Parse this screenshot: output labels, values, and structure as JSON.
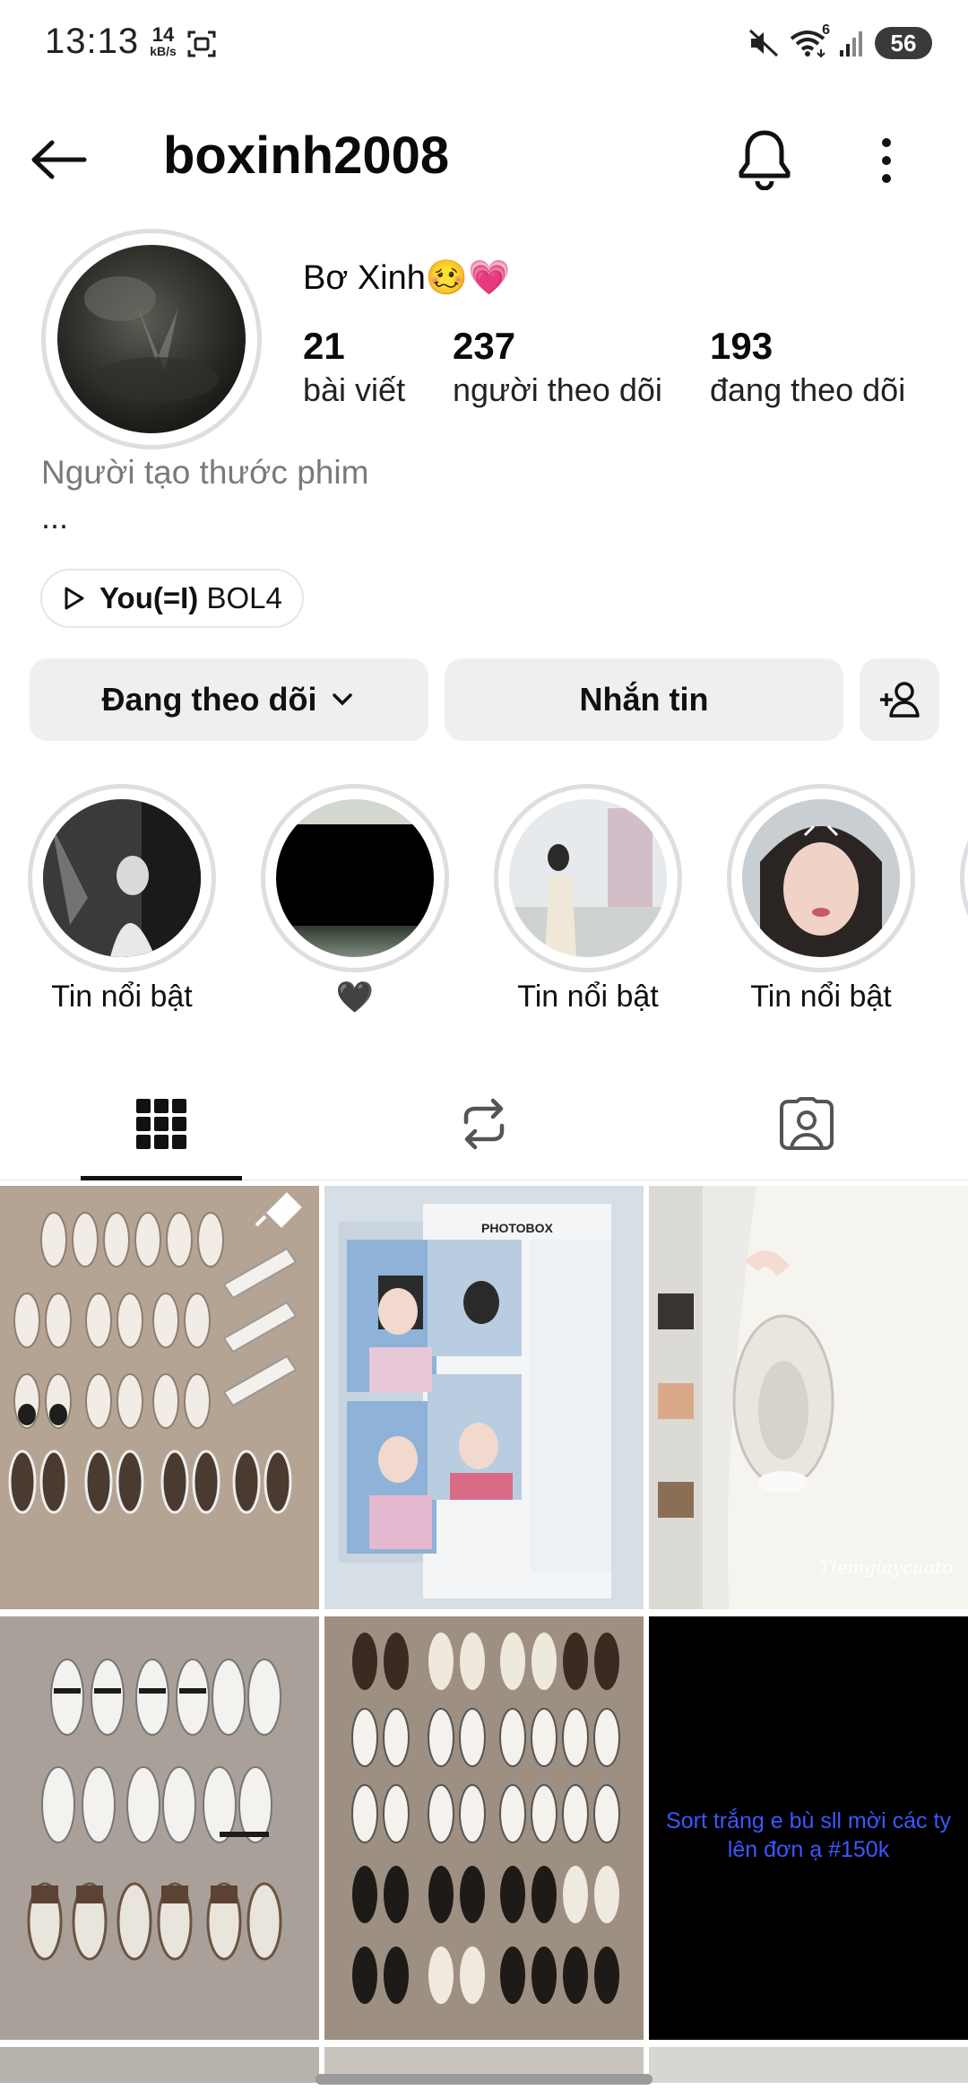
{
  "status_bar": {
    "time": "13:13",
    "speed_value": "14",
    "speed_unit": "kB/s",
    "wifi_badge": "6",
    "battery": "56"
  },
  "header": {
    "username": "boxinh2008"
  },
  "profile": {
    "display_name": "Bơ Xinh🥴💗",
    "stats": [
      {
        "value": "21",
        "label": "bài viết"
      },
      {
        "value": "237",
        "label": "người theo dõi"
      },
      {
        "value": "193",
        "label": "đang theo dõi"
      }
    ],
    "category": "Người tạo thước phim",
    "bio_more": "...",
    "music_title": "You(=I)",
    "music_artist": "BOL4"
  },
  "actions": {
    "following_label": "Đang theo dõi",
    "message_label": "Nhắn tin"
  },
  "highlights": [
    {
      "label": "Tin nổi bật"
    },
    {
      "label": "🖤"
    },
    {
      "label": "Tin nổi bật"
    },
    {
      "label": "Tin nổi bật"
    }
  ],
  "grid": {
    "post_text": "Sort trắng e bù sll mời các ty lên đơn ạ #150k",
    "photobox_label": "PHOTOBOX",
    "watermark": "Tiemgiaycuato"
  },
  "colors": {
    "accent_text": "#3c57ff",
    "button_bg": "#efeff2",
    "ring": "#dddde3"
  }
}
